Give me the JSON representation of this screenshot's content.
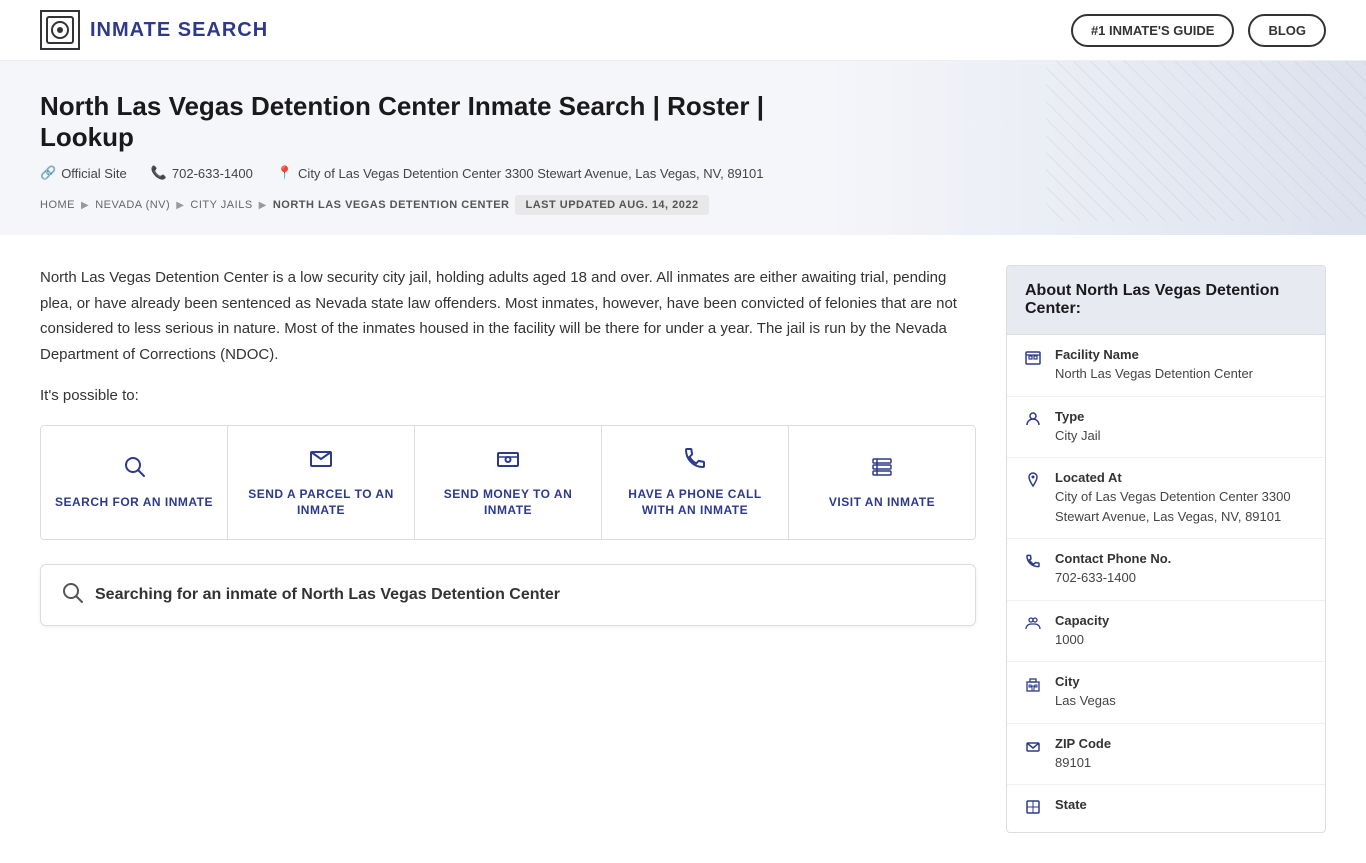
{
  "header": {
    "logo_text": "INMATE SEARCH",
    "logo_icon": "🏛",
    "nav": [
      {
        "label": "#1 INMATE'S GUIDE",
        "id": "inmates-guide-btn"
      },
      {
        "label": "BLOG",
        "id": "blog-btn"
      }
    ]
  },
  "hero": {
    "title": "North Las Vegas Detention Center Inmate Search | Roster | Lookup",
    "official_site_label": "Official Site",
    "phone_label": "702-633-1400",
    "location_label": "City of Las Vegas Detention Center 3300 Stewart Avenue, Las Vegas, NV, 89101",
    "breadcrumb": [
      {
        "label": "HOME",
        "href": "#"
      },
      {
        "label": "NEVADA (NV)",
        "href": "#"
      },
      {
        "label": "CITY JAILS",
        "href": "#"
      },
      {
        "label": "NORTH LAS VEGAS DETENTION CENTER",
        "href": "#"
      }
    ],
    "last_updated": "LAST UPDATED AUG. 14, 2022"
  },
  "main": {
    "description": "North Las Vegas Detention Center is a low security city jail, holding adults aged 18 and over. All inmates are either awaiting trial, pending plea, or have already been sentenced as Nevada state law offenders. Most inmates, however, have been convicted of felonies that are not considered to less serious in nature. Most of the inmates housed in the facility will be there for under a year. The jail is run by the Nevada Department of Corrections (NDOC).",
    "possible_text": "It's possible to:",
    "action_cards": [
      {
        "id": "search",
        "icon": "🔍",
        "label": "SEARCH FOR AN INMATE"
      },
      {
        "id": "parcel",
        "icon": "✉",
        "label": "SEND A PARCEL TO AN INMATE"
      },
      {
        "id": "money",
        "icon": "💳",
        "label": "SEND MONEY TO AN INMATE"
      },
      {
        "id": "phone",
        "icon": "📞",
        "label": "HAVE A PHONE CALL WITH AN INMATE"
      },
      {
        "id": "visit",
        "icon": "👁",
        "label": "VISIT AN INMATE"
      }
    ],
    "search_placeholder": "Searching for an inmate of North Las Vegas Detention Center"
  },
  "sidebar": {
    "header": "About North Las Vegas Detention Center:",
    "fields": [
      {
        "id": "facility-name",
        "icon": "🏢",
        "label": "Facility Name",
        "value": "North Las Vegas Detention Center"
      },
      {
        "id": "type",
        "icon": "👤",
        "label": "Type",
        "value": "City Jail"
      },
      {
        "id": "located-at",
        "icon": "📍",
        "label": "Located At",
        "value": "City of Las Vegas Detention Center 3300 Stewart Avenue, Las Vegas, NV, 89101"
      },
      {
        "id": "phone",
        "icon": "📞",
        "label": "Contact Phone No.",
        "value": "702-633-1400"
      },
      {
        "id": "capacity",
        "icon": "👥",
        "label": "Capacity",
        "value": "1000"
      },
      {
        "id": "city",
        "icon": "🏙",
        "label": "City",
        "value": "Las Vegas"
      },
      {
        "id": "zip",
        "icon": "✉",
        "label": "ZIP Code",
        "value": "89101"
      },
      {
        "id": "state",
        "icon": "🗺",
        "label": "State",
        "value": ""
      }
    ]
  }
}
